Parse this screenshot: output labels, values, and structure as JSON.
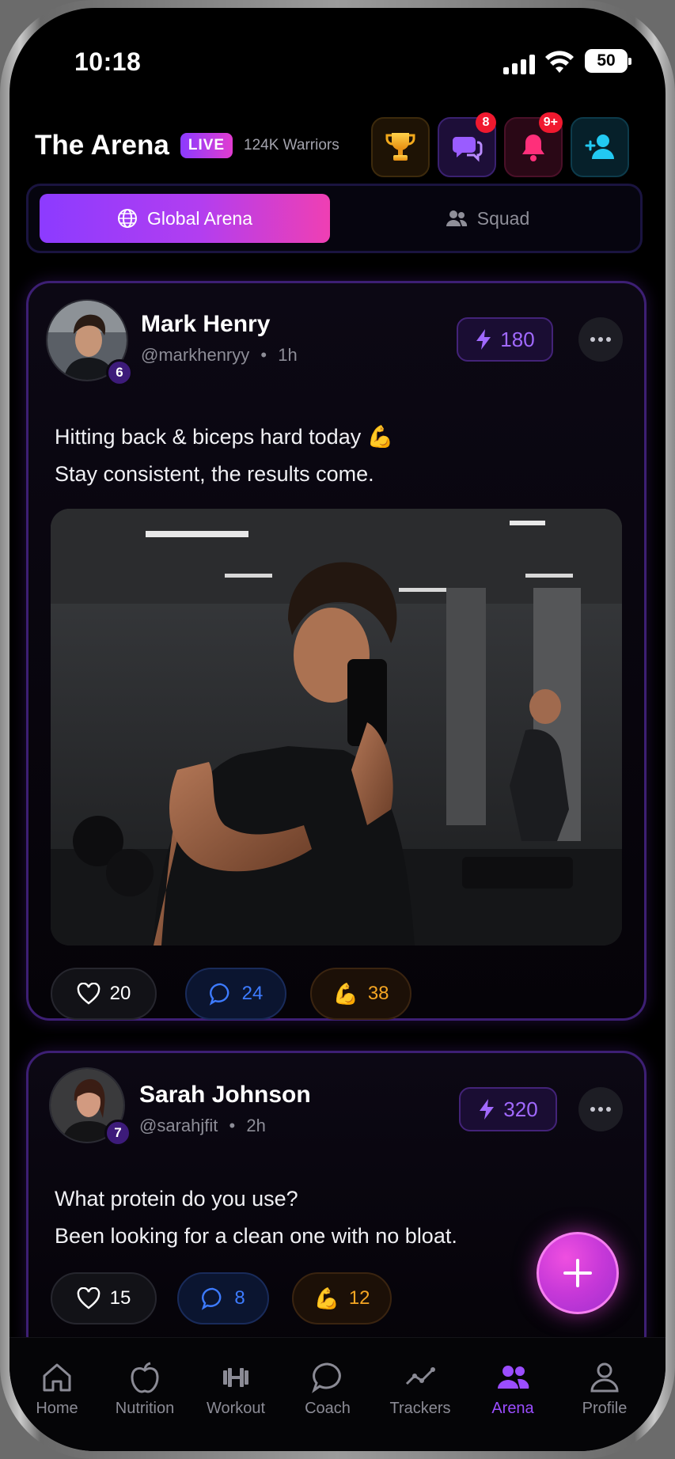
{
  "status_bar": {
    "time": "10:18",
    "battery": "50"
  },
  "header": {
    "title": "The Arena",
    "live_label": "LIVE",
    "warriors": "124K Warriors",
    "chat_badge": "8",
    "bell_badge": "9+",
    "icons": [
      "trophy-icon",
      "chat-icon",
      "bell-icon",
      "add-user-icon"
    ]
  },
  "segments": {
    "active": "Global Arena",
    "inactive": "Squad"
  },
  "posts": [
    {
      "name": "Mark Henry",
      "handle": "@markhenryy",
      "time": "1h",
      "level": "6",
      "xp": "180",
      "text_line1": "Hitting back & biceps hard today 💪",
      "text_line2": "Stay consistent, the results come.",
      "likes": "20",
      "comments": "24",
      "flexes": "38"
    },
    {
      "name": "Sarah Johnson",
      "handle": "@sarahjfit",
      "time": "2h",
      "level": "7",
      "xp": "320",
      "text_line1": "What protein do you use?",
      "text_line2": "Been looking for a clean one with no bloat.",
      "likes": "15",
      "comments": "8",
      "flexes": "12"
    }
  ],
  "tabbar": {
    "items": [
      "Home",
      "Nutrition",
      "Workout",
      "Coach",
      "Trackers",
      "Arena",
      "Profile"
    ],
    "active": "Arena"
  },
  "colors": {
    "accent": "#9b4dff",
    "pink": "#ef3fb3",
    "comment_blue": "#3d7bff",
    "flex_orange": "#f5a623"
  }
}
